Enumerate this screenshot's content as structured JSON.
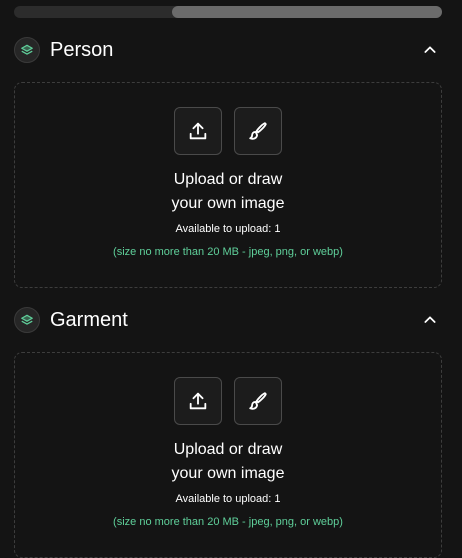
{
  "scrollbar": {
    "thumb_start_fraction": 0.37,
    "thumb_size_fraction": 0.63
  },
  "sections": [
    {
      "title": "Person",
      "icon": "layers-icon",
      "collapse_icon": "chevron-up-icon",
      "upload_icon": "upload-icon",
      "draw_icon": "paintbrush-icon",
      "title_line1": "Upload or draw",
      "title_line2": "your own image",
      "available": "Available to upload: 1",
      "size_note": "(size no more than 20 MB - jpeg, png, or webp)"
    },
    {
      "title": "Garment",
      "icon": "layers-icon",
      "collapse_icon": "chevron-up-icon",
      "upload_icon": "upload-icon",
      "draw_icon": "paintbrush-icon",
      "title_line1": "Upload or draw",
      "title_line2": "your own image",
      "available": "Available to upload: 1",
      "size_note": "(size no more than 20 MB - jpeg, png, or webp)"
    }
  ],
  "colors": {
    "background": "#141414",
    "accent_green": "#5fcf9a",
    "border": "#3d3d3d"
  }
}
